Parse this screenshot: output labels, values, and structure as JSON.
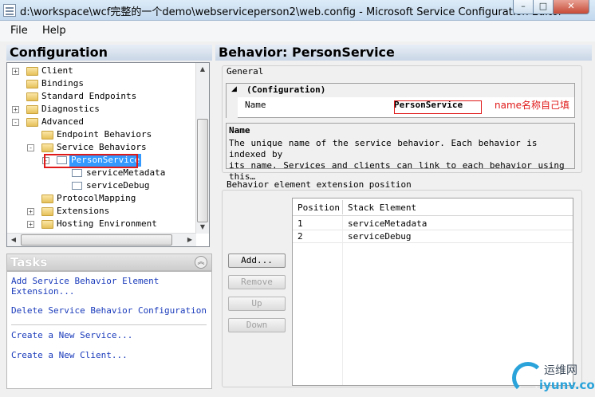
{
  "window": {
    "title": "d:\\workspace\\wcf完整的一个demo\\webserviceperson2\\web.config - Microsoft Service Configuration Editor",
    "minimize": "–",
    "maximize": "□",
    "close": "✕"
  },
  "menu": {
    "file": "File",
    "help": "Help"
  },
  "configuration": {
    "header": "Configuration",
    "tree": [
      {
        "label": "Client",
        "expander": "+"
      },
      {
        "label": "Bindings",
        "expander": ""
      },
      {
        "label": "Standard Endpoints",
        "expander": ""
      },
      {
        "label": "Diagnostics",
        "expander": "+"
      },
      {
        "label": "Advanced",
        "expander": "-"
      },
      {
        "label": "Endpoint Behaviors",
        "expander": ""
      },
      {
        "label": "Service Behaviors",
        "expander": "-"
      },
      {
        "label": "PersonService",
        "expander": "-",
        "selected": true
      },
      {
        "label": "serviceMetadata",
        "expander": ""
      },
      {
        "label": "serviceDebug",
        "expander": ""
      },
      {
        "label": "ProtocolMapping",
        "expander": ""
      },
      {
        "label": "Extensions",
        "expander": "+"
      },
      {
        "label": "Hosting Environment",
        "expander": "+"
      }
    ]
  },
  "tasks": {
    "header": "Tasks",
    "collapse": "︽",
    "items": [
      "Add Service Behavior Element",
      "Extension...",
      "Delete Service Behavior Configuration",
      "Create a New Service...",
      "Create a New Client..."
    ]
  },
  "behavior": {
    "header": "Behavior: PersonService",
    "general_label": "General",
    "grid": {
      "category": "(Configuration)",
      "name_label": "Name",
      "name_value": "PersonService",
      "annotation": "name名称自己填"
    },
    "description": {
      "title": "Name",
      "line1": "The unique name of the service behavior. Each behavior is indexed by",
      "line2": "its name. Services and clients can link to each behavior using this…"
    },
    "extension_label": "Behavior element extension position",
    "buttons": {
      "add": "Add...",
      "remove": "Remove",
      "up": "Up",
      "down": "Down"
    },
    "table": {
      "columns": [
        "Position",
        "Stack Element"
      ],
      "rows": [
        {
          "position": "1",
          "element": "serviceMetadata"
        },
        {
          "position": "2",
          "element": "serviceDebug"
        }
      ]
    }
  },
  "watermark": {
    "top": "运维网",
    "bottom": "iyunv.com"
  }
}
